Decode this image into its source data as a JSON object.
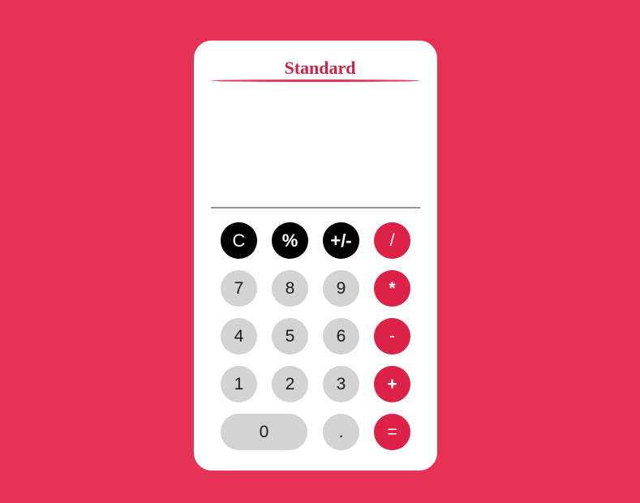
{
  "title": "Standard",
  "display": {
    "value": ""
  },
  "keys": {
    "clear": "C",
    "percent": "%",
    "sign": "+/-",
    "divide": "/",
    "seven": "7",
    "eight": "8",
    "nine": "9",
    "multiply": "*",
    "four": "4",
    "five": "5",
    "six": "6",
    "subtract": "-",
    "one": "1",
    "two": "2",
    "three": "3",
    "add": "+",
    "zero": "0",
    "decimal": ".",
    "equals": "="
  },
  "colors": {
    "background": "#e63355",
    "panel": "#ffffff",
    "title": "#cc2244",
    "function_key": "#000000",
    "number_key": "#d3d3d3",
    "operator_key": "#dc2347"
  }
}
